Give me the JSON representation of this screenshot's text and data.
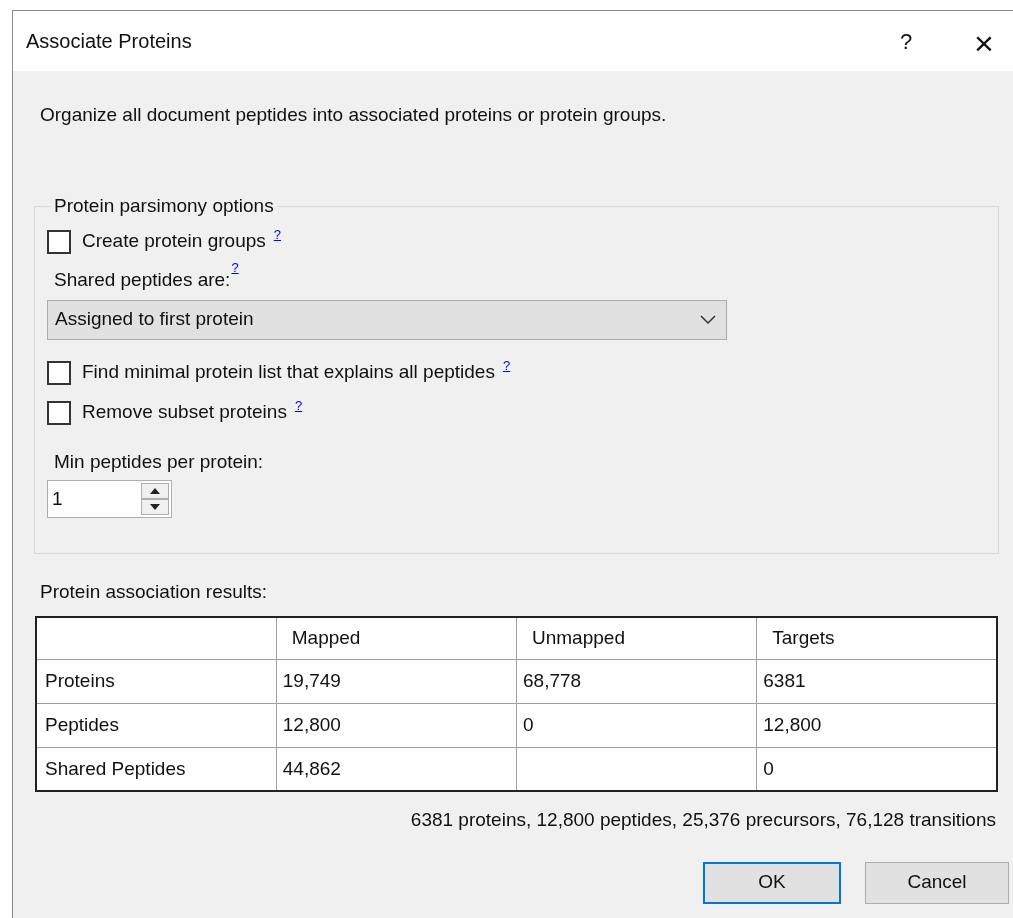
{
  "window": {
    "title": "Associate Proteins",
    "help_button": "?",
    "close_button": "×"
  },
  "description": "Organize all document peptides into associated proteins or protein groups.",
  "parsimony": {
    "title": "Protein parsimony options",
    "create_groups": {
      "label": "Create protein groups",
      "help": "?",
      "checked": false
    },
    "shared": {
      "label": "Shared peptides are:",
      "help": "?",
      "value": "Assigned to first protein"
    },
    "options": [
      {
        "label": "Find minimal protein list that explains all peptides",
        "help": "?",
        "checked": false
      },
      {
        "label": "Remove subset proteins",
        "help": "?",
        "checked": false
      }
    ],
    "min_peptides": {
      "label": "Min peptides per protein:",
      "value": "1"
    }
  },
  "results": {
    "title": "Protein association results:",
    "columns": [
      "",
      "Mapped",
      "Unmapped",
      "Targets"
    ],
    "rows": [
      [
        "Proteins",
        "19,749",
        "68,778",
        "6381"
      ],
      [
        "Peptides",
        "12,800",
        "0",
        "12,800"
      ],
      [
        "Shared Peptides",
        "44,862",
        "",
        "0"
      ]
    ]
  },
  "summary": "6381 proteins, 12,800 peptides, 25,376 precursors, 76,128 transitions",
  "buttons": [
    {
      "label": "OK",
      "default": true
    },
    {
      "label": "Cancel",
      "default": false
    }
  ]
}
